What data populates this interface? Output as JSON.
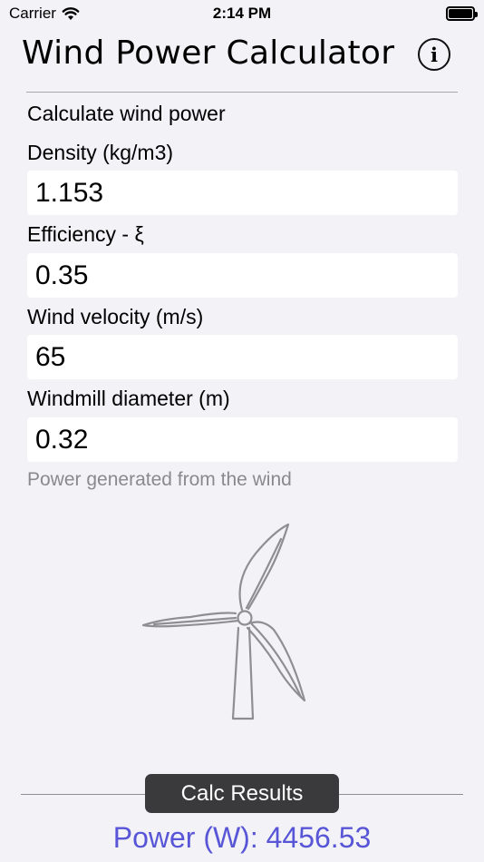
{
  "status_bar": {
    "carrier": "Carrier",
    "time": "2:14 PM"
  },
  "header": {
    "title": "Wind Power Calculator",
    "info_icon": "info-circle-icon",
    "info_glyph": "i"
  },
  "form": {
    "section_title": "Calculate wind power",
    "fields": [
      {
        "label": "Density (kg/m3)",
        "value": "1.153"
      },
      {
        "label": "Efficiency - ξ",
        "value": "0.35"
      },
      {
        "label": "Wind velocity (m/s)",
        "value": "65"
      },
      {
        "label": "Windmill diameter (m)",
        "value": "0.32"
      }
    ],
    "hint": "Power generated from the wind"
  },
  "illustration": "wind-turbine-icon",
  "footer": {
    "calc_button": "Calc Results",
    "result": "Power (W): 4456.53"
  },
  "colors": {
    "background": "#f2f2f7",
    "result_text": "#5856d6",
    "button_bg": "#3a3a3c"
  }
}
